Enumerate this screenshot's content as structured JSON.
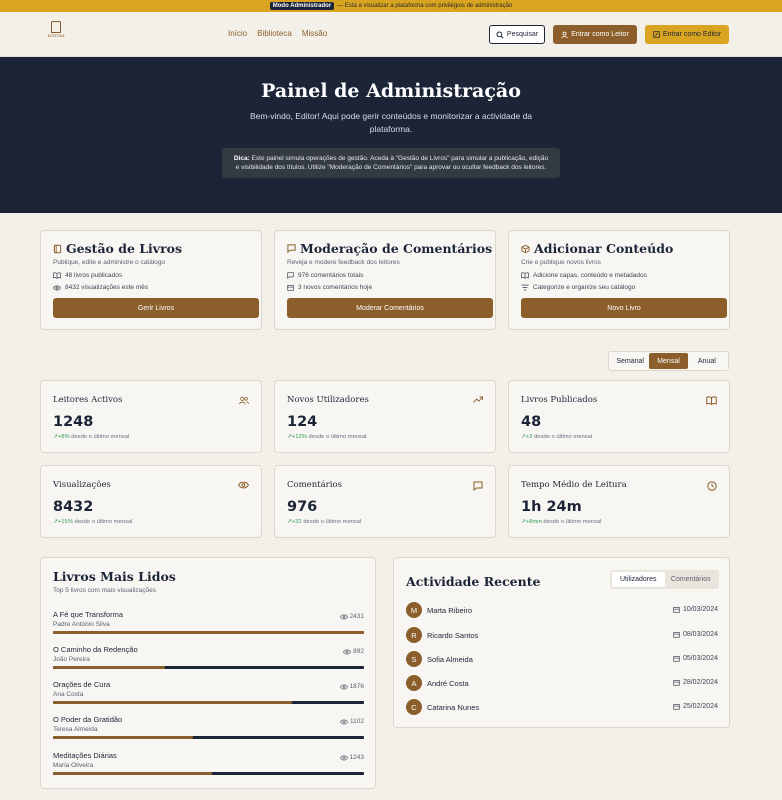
{
  "admin_banner": {
    "tag": "Modo Administrador",
    "text": "— Está a visualizar a plataforma com privilégios de administração"
  },
  "nav": {
    "logo_text": "EDITORA",
    "links": [
      "Início",
      "Biblioteca",
      "Missão"
    ],
    "search_label": "Pesquisar",
    "reader_label": "Entrar como Leitor",
    "editor_label": "Entrar como Editor"
  },
  "hero": {
    "title": "Painel de Administração",
    "subtitle": "Bem-vindo, Editor! Aqui pode gerir conteúdos e monitorizar a actividade da plataforma.",
    "tip_label": "Dica:",
    "tip_text": " Este painel simula operações de gestão. Aceda à \"Gestão de Livros\" para simular a publicação, edição e visibilidade dos títulos. Utilize \"Moderação de Comentários\" para aprovar ou ocultar feedback dos leitores."
  },
  "quick_actions": [
    {
      "title": "Gestão de Livros",
      "desc": "Publique, edite e administre o catálogo",
      "stat1": "48 livros publicados",
      "stat2": "8432 visualizações este mês",
      "button": "Gerir Livros"
    },
    {
      "title": "Moderação de Comentários",
      "desc": "Reveja e modere feedback dos leitores",
      "stat1": "976 comentários totais",
      "stat2": "3 novos comentários hoje",
      "button": "Moderar Comentários"
    },
    {
      "title": "Adicionar Conteúdo",
      "desc": "Crie e publique novos livros",
      "stat1": "Adicione capas, conteúdo e metadados",
      "stat2": "Categorize e organize seu catálogo",
      "button": "Novo Livro"
    }
  ],
  "period": {
    "options": [
      "Semanal",
      "Mensal",
      "Anual"
    ],
    "selected": "Mensal"
  },
  "metrics": [
    {
      "label": "Leitores Activos",
      "value": "1248",
      "change": "+8%",
      "suffix": " desde o último mensal",
      "icon": "users-icon"
    },
    {
      "label": "Novos Utilizadores",
      "value": "124",
      "change": "+12%",
      "suffix": " desde o último mensal",
      "icon": "trend-up-icon"
    },
    {
      "label": "Livros Publicados",
      "value": "48",
      "change": "+3",
      "suffix": " desde o último mensal",
      "icon": "book-open-icon"
    },
    {
      "label": "Visualizações",
      "value": "8432",
      "change": "+15%",
      "suffix": " desde o último mensal",
      "icon": "eye-icon"
    },
    {
      "label": "Comentários",
      "value": "976",
      "change": "+32",
      "suffix": " desde o último mensal",
      "icon": "message-icon"
    },
    {
      "label": "Tempo Médio de Leitura",
      "value": "1h 24m",
      "change": "+8min",
      "suffix": " desde o último mensal",
      "icon": "clock-icon"
    }
  ],
  "top_books": {
    "title": "Livros Mais Lidos",
    "subtitle": "Top 5 livros com mais visualizações",
    "items": [
      {
        "title": "A Fé que Transforma",
        "author": "Padre António Silva",
        "views": "2431",
        "share": 1.0
      },
      {
        "title": "O Caminho da Redenção",
        "author": "João Pereira",
        "views": "892",
        "share": 0.36
      },
      {
        "title": "Orações de Cura",
        "author": "Ana Costa",
        "views": "1876",
        "share": 0.77
      },
      {
        "title": "O Poder da Gratidão",
        "author": "Teresa Almeida",
        "views": "1102",
        "share": 0.45
      },
      {
        "title": "Meditações Diárias",
        "author": "Maria Oliveira",
        "views": "1243",
        "share": 0.51
      }
    ]
  },
  "activity": {
    "title": "Actividade Recente",
    "tabs": [
      "Utilizadores",
      "Comentários"
    ],
    "selected_tab": "Utilizadores",
    "items": [
      {
        "initial": "M",
        "name": "Marta Ribeiro",
        "date": "10/03/2024"
      },
      {
        "initial": "R",
        "name": "Ricardo Santos",
        "date": "08/03/2024"
      },
      {
        "initial": "S",
        "name": "Sofia Almeida",
        "date": "05/03/2024"
      },
      {
        "initial": "A",
        "name": "André Costa",
        "date": "28/02/2024"
      },
      {
        "initial": "C",
        "name": "Catarina Nunes",
        "date": "25/02/2024"
      }
    ]
  },
  "colors": {
    "navy": "#1c2537",
    "brown": "#8b5e2b",
    "gold": "#d9a520",
    "green": "#2f9a57"
  }
}
